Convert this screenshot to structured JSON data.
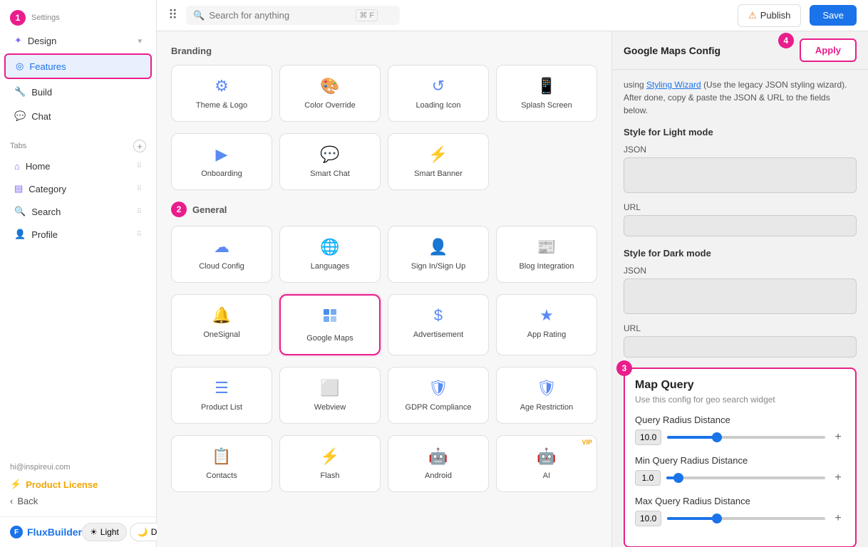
{
  "sidebar": {
    "settings_label": "Settings",
    "design_label": "Design",
    "features_label": "Features",
    "build_label": "Build",
    "chat_label": "Chat",
    "tabs_label": "Tabs",
    "add_tab_label": "+",
    "tabs": [
      {
        "id": "home",
        "label": "Home",
        "icon": "🏠"
      },
      {
        "id": "category",
        "label": "Category",
        "icon": "☰"
      },
      {
        "id": "search",
        "label": "Search",
        "icon": "🔍"
      },
      {
        "id": "profile",
        "label": "Profile",
        "icon": "👤"
      }
    ],
    "user_email": "hi@inspireui.com",
    "license_label": "Product License",
    "back_label": "Back",
    "flux_label": "FluxBuilder"
  },
  "topbar": {
    "search_placeholder": "Search for anything",
    "shortcut": "⌘ F",
    "publish_label": "Publish",
    "save_label": "Save"
  },
  "right_panel": {
    "title": "Google Maps Config",
    "apply_label": "Apply",
    "intro_text": "using ",
    "styling_wizard": "Styling Wizard",
    "intro_rest": " (Use the legacy JSON styling wizard). After done, copy & paste the JSON & URL to the fields below.",
    "light_mode_label": "Style for Light mode",
    "json_label": "JSON",
    "url_label": "URL",
    "dark_mode_label": "Style for Dark mode",
    "map_query_title": "Map Query",
    "map_query_subtitle": "Use this config for geo search widget",
    "query_radius_label": "Query Radius Distance",
    "query_radius_value": "10.0",
    "min_query_radius_label": "Min Query Radius Distance",
    "min_query_radius_value": "1.0",
    "max_query_radius_label": "Max Query Radius Distance",
    "max_query_radius_value": "10.0"
  },
  "branding": {
    "title": "Branding",
    "items": [
      {
        "id": "theme-logo",
        "label": "Theme & Logo",
        "icon": "theme"
      },
      {
        "id": "color-override",
        "label": "Color Override",
        "icon": "color"
      },
      {
        "id": "loading-icon",
        "label": "Loading Icon",
        "icon": "loading"
      },
      {
        "id": "splash-screen",
        "label": "Splash Screen",
        "icon": "splash"
      }
    ]
  },
  "branding2": {
    "items": [
      {
        "id": "onboarding",
        "label": "Onboarding",
        "icon": "onboarding"
      },
      {
        "id": "smart-chat",
        "label": "Smart Chat",
        "icon": "chat"
      },
      {
        "id": "smart-banner",
        "label": "Smart Banner",
        "icon": "banner"
      }
    ]
  },
  "general": {
    "title": "General",
    "items": [
      {
        "id": "cloud-config",
        "label": "Cloud Config",
        "icon": "cloud"
      },
      {
        "id": "languages",
        "label": "Languages",
        "icon": "lang"
      },
      {
        "id": "sign-in-up",
        "label": "Sign In/Sign Up",
        "icon": "signin"
      },
      {
        "id": "blog-integration",
        "label": "Blog Integration",
        "icon": "blog"
      }
    ]
  },
  "general2": {
    "items": [
      {
        "id": "onesignal",
        "label": "OneSignal",
        "icon": "bell"
      },
      {
        "id": "google-maps",
        "label": "Google Maps",
        "icon": "maps",
        "selected": true
      },
      {
        "id": "advertisement",
        "label": "Advertisement",
        "icon": "ad"
      },
      {
        "id": "app-rating",
        "label": "App Rating",
        "icon": "star"
      }
    ]
  },
  "general3": {
    "items": [
      {
        "id": "product-list",
        "label": "Product List",
        "icon": "list"
      },
      {
        "id": "webview",
        "label": "Webview",
        "icon": "web"
      },
      {
        "id": "gdpr",
        "label": "GDPR Compliance",
        "icon": "shield"
      },
      {
        "id": "age-restriction",
        "label": "Age Restriction",
        "icon": "age"
      }
    ]
  },
  "general4": {
    "items": [
      {
        "id": "contacts",
        "label": "Contacts",
        "icon": "contacts"
      },
      {
        "id": "flash",
        "label": "Flash",
        "icon": "flash"
      },
      {
        "id": "android",
        "label": "Android",
        "icon": "android"
      },
      {
        "id": "ai",
        "label": "AI",
        "icon": "ai",
        "vip": true
      }
    ]
  },
  "theme": {
    "light_label": "Light",
    "dark_label": "Dark"
  },
  "badges": {
    "num1": "1",
    "num2": "2",
    "num3": "3",
    "num4": "4"
  }
}
